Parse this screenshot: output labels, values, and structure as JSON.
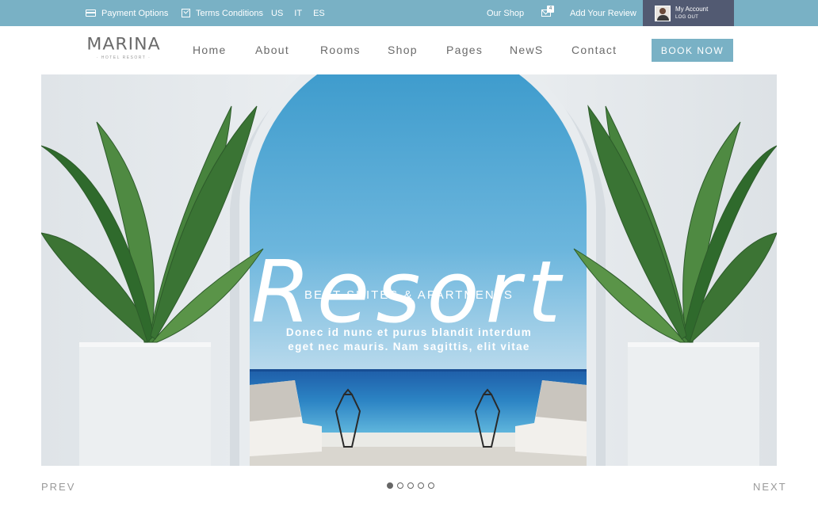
{
  "topbar": {
    "payment_options": "Payment Options",
    "terms": "Terms Conditions",
    "languages": [
      "US",
      "IT",
      "ES"
    ],
    "our_shop": "Our Shop",
    "mail_count": "4",
    "add_review": "Add Your Review",
    "account": {
      "title": "My Account",
      "logout": "LOG OUT"
    }
  },
  "header": {
    "logo": {
      "name": "MARINA",
      "subtitle": "· HOTEL RESORT ·"
    },
    "nav": [
      "Home",
      "About",
      "Rooms",
      "Shop",
      "Pages",
      "NewS",
      "Contact"
    ],
    "book_now": "BOOK NOW"
  },
  "hero": {
    "title": "Resort",
    "subtitle": "BEST SUITES & APARTMENTS",
    "description_line1": "Donec id nunc et purus blandit interdum",
    "description_line2": "eget nec mauris. Nam sagittis, elit vitae"
  },
  "slider": {
    "prev": "PREV",
    "next": "NEXT",
    "dot_count": 5,
    "active_dot": 1
  },
  "colors": {
    "topbar": "#79b1c5",
    "account_bg": "#525a72",
    "accent": "#79b1c5",
    "nav_text": "#6a6a6a"
  },
  "icons": [
    "credit-card-icon",
    "checkbox-icon",
    "mail-icon",
    "avatar"
  ]
}
